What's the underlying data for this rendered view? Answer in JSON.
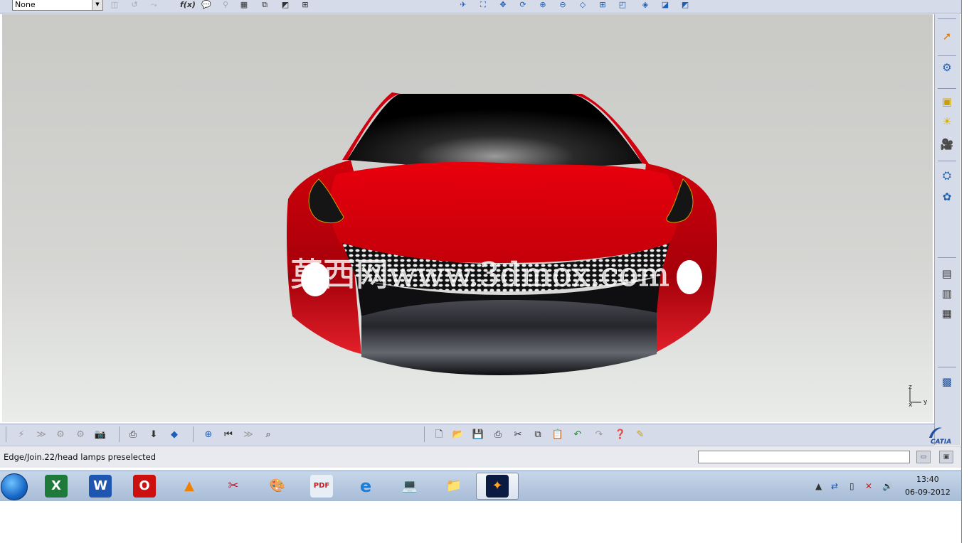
{
  "top_toolbar": {
    "select_value": "None",
    "formula_label": "f(x)"
  },
  "viewport": {
    "watermark": "莫西网www.3dmox.com",
    "axis_z": "z",
    "axis_x": "x",
    "axis_y": "y"
  },
  "right_toolbar": {
    "icons": [
      "select-icon",
      "sketch-analysis-icon",
      "normal-view-icon",
      "lighting-icon",
      "camera-icon",
      "apply-material-icon",
      "render-settings-icon",
      "scene-icon",
      "turntable-icon",
      "shooting-icon",
      "catia-v5-icon"
    ]
  },
  "bottom_toolbar": {
    "icons": [
      "new-file-icon",
      "open-icon",
      "save-icon",
      "print-icon",
      "cut-icon",
      "copy-icon",
      "paste-icon",
      "undo-icon",
      "redo-icon",
      "whats-this-icon"
    ]
  },
  "status": {
    "message": "Edge/Join.22/head lamps preselected",
    "brand": "CATIA"
  },
  "taskbar": {
    "time": "13:40",
    "date": "06-09-2012",
    "apps": [
      "excel-icon",
      "word-icon",
      "opera-icon",
      "vlc-icon",
      "snipping-tool-icon",
      "paint-icon",
      "pdf-icon",
      "internet-explorer-icon",
      "computer-icon",
      "file-explorer-icon",
      "catia-taskbar-icon"
    ]
  }
}
